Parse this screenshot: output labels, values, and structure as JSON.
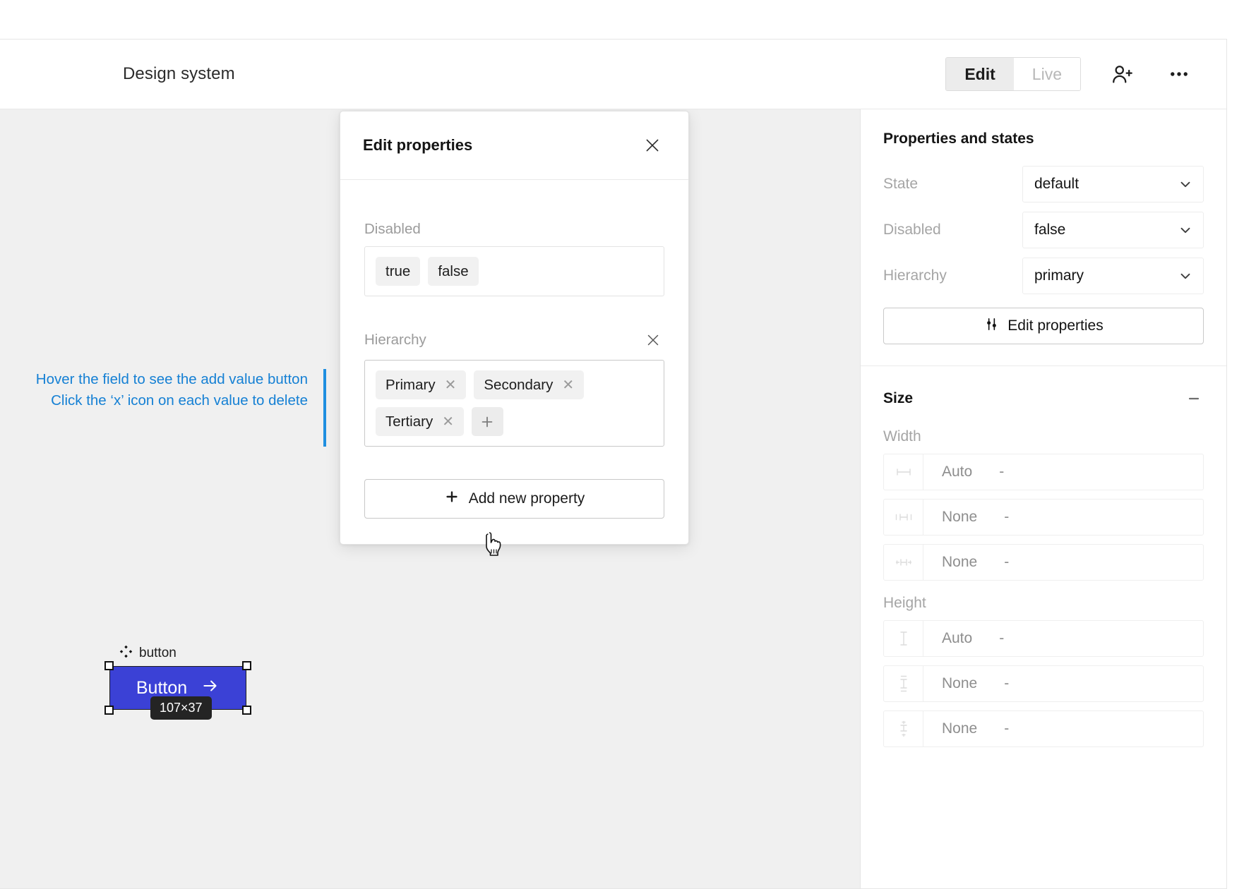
{
  "header": {
    "title": "Design system",
    "mode_toggle": [
      {
        "label": "Edit",
        "active": true
      },
      {
        "label": "Live",
        "active": false
      }
    ],
    "invite_icon": "person-add-icon",
    "more_icon": "more-horizontal-icon"
  },
  "canvas": {
    "annotation": {
      "line1": "Hover the field to see the add value button",
      "line2": "Click the ‘x’ icon on each value to delete",
      "color": "#1580d4"
    },
    "component": {
      "label": "button",
      "label_icon": "component-diamond-icon",
      "button_text": "Button",
      "button_icon": "arrow-right-icon",
      "button_color": "#3b41d6",
      "size_badge": "107×37"
    },
    "cursor_icon": "pointing-hand-cursor"
  },
  "modal": {
    "title": "Edit properties",
    "close_icon": "close-icon",
    "fields": [
      {
        "label": "Disabled",
        "removable": false,
        "chips": [
          {
            "text": "true",
            "deletable": false
          },
          {
            "text": "false",
            "deletable": false
          }
        ],
        "show_add": false
      },
      {
        "label": "Hierarchy",
        "removable": true,
        "remove_icon": "close-icon",
        "chips": [
          {
            "text": "Primary",
            "deletable": true
          },
          {
            "text": "Secondary",
            "deletable": true
          },
          {
            "text": "Tertiary",
            "deletable": true
          }
        ],
        "show_add": true,
        "add_icon": "plus-icon"
      }
    ],
    "add_property_label": "Add new property",
    "add_property_icon": "plus-icon"
  },
  "right_panel": {
    "properties": {
      "heading": "Properties and states",
      "rows": [
        {
          "name": "State",
          "value": "default",
          "chevron": "chevron-down-icon"
        },
        {
          "name": "Disabled",
          "value": "false",
          "chevron": "chevron-down-icon"
        },
        {
          "name": "Hierarchy",
          "value": "primary",
          "chevron": "chevron-down-icon"
        }
      ],
      "edit_button": "Edit properties",
      "edit_button_icon": "sliders-icon"
    },
    "size": {
      "heading": "Size",
      "collapse_icon": "minus-icon",
      "width_label": "Width",
      "width_rows": [
        {
          "icon": "width-icon",
          "value": "Auto",
          "unit": "-"
        },
        {
          "icon": "min-width-icon",
          "value": "None",
          "unit": "-"
        },
        {
          "icon": "max-width-icon",
          "value": "None",
          "unit": "-"
        }
      ],
      "height_label": "Height",
      "height_rows": [
        {
          "icon": "height-icon",
          "value": "Auto",
          "unit": "-"
        },
        {
          "icon": "min-height-icon",
          "value": "None",
          "unit": "-"
        },
        {
          "icon": "max-height-icon",
          "value": "None",
          "unit": "-"
        }
      ]
    }
  }
}
